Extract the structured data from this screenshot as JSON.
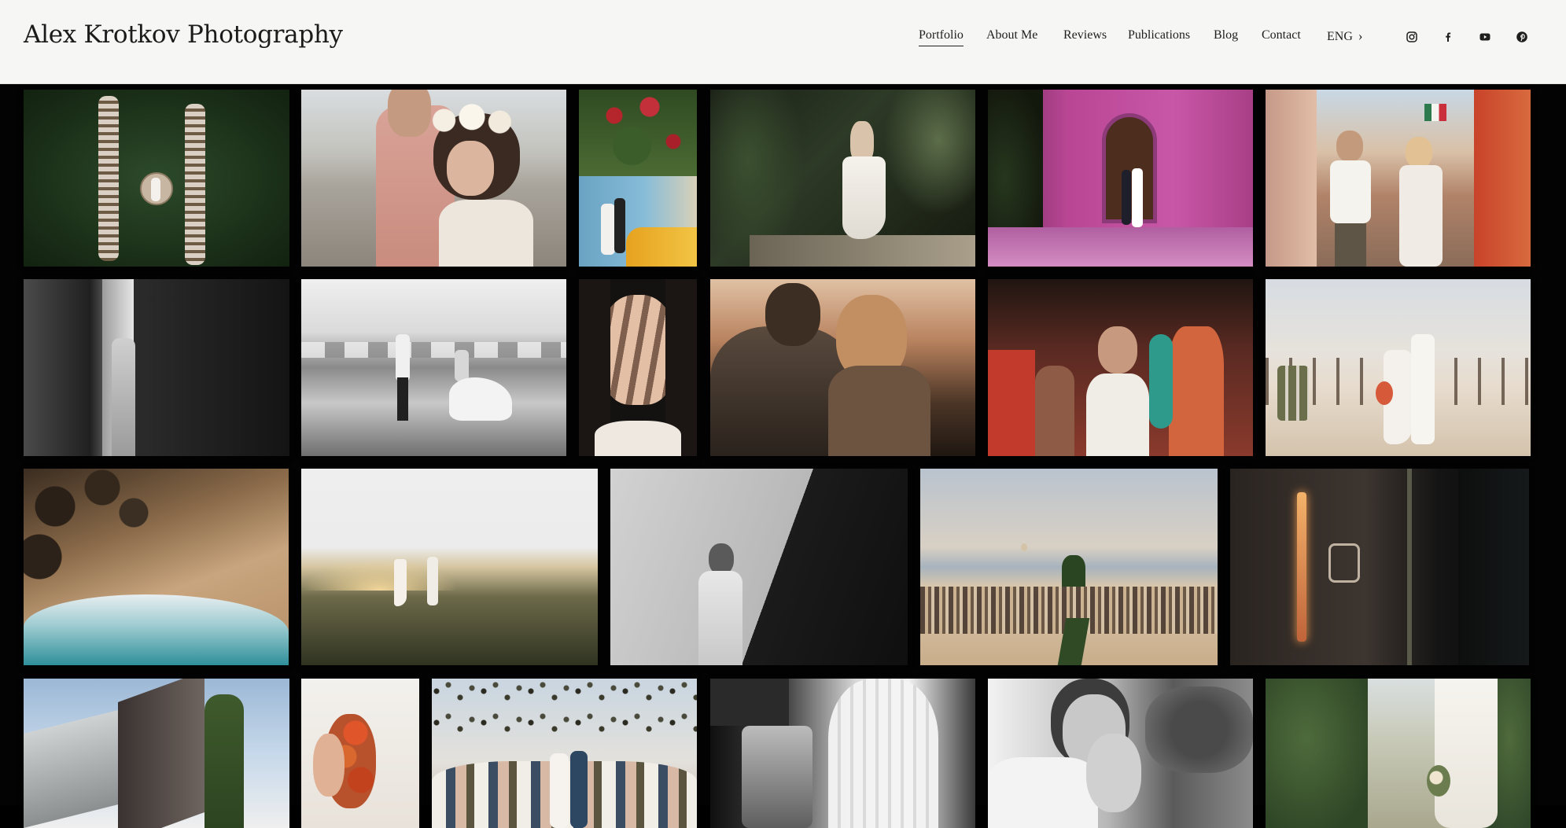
{
  "site": {
    "title": "Alex Krotkov Photography"
  },
  "nav": {
    "items": [
      "Portfolio",
      "About Me",
      "Reviews",
      "Publications",
      "Blog",
      "Contact"
    ],
    "active": "Portfolio",
    "language": "ENG"
  },
  "social_icons": [
    "instagram-icon",
    "facebook-icon",
    "youtube-icon",
    "pinterest-icon"
  ],
  "colors": {
    "header_bg": "#f6f6f5",
    "grid_bg": "#030303",
    "text": "#1e1e1e"
  },
  "gallery": {
    "photos": [
      "aerial-ceremony-rows-on-lawn",
      "groom-in-pink-suit-hugging-bride-with-flower-crown",
      "couple-by-blue-wall-with-bougainvillea-and-taxi",
      "bride-walking-through-garden-path",
      "couple-at-pink-wall-wooden-door",
      "couple-walking-colorful-street-with-flag",
      "bride-in-dark-corridor-bw",
      "couple-holding-hands-in-surf-bw",
      "bride-portrait-with-light-stripes",
      "couple-embracing-at-sunset",
      "bride-dancing-with-guests",
      "couple-at-beach-ceremony-chairs",
      "aerial-rocky-coast-waves",
      "couple-walking-through-grassy-hills",
      "groom-in-light-and-shadow-bw",
      "beach-ceremony-with-balloon",
      "aerial-reception-table-with-lights",
      "bride-by-modern-wall-with-cactus",
      "bride-with-orange-flowers-in-hair",
      "confetti-toss-wedding-party",
      "couple-with-veil-bw",
      "couple-laughing-close-up-bw",
      "bride-holding-bouquet-among-cacti"
    ]
  }
}
